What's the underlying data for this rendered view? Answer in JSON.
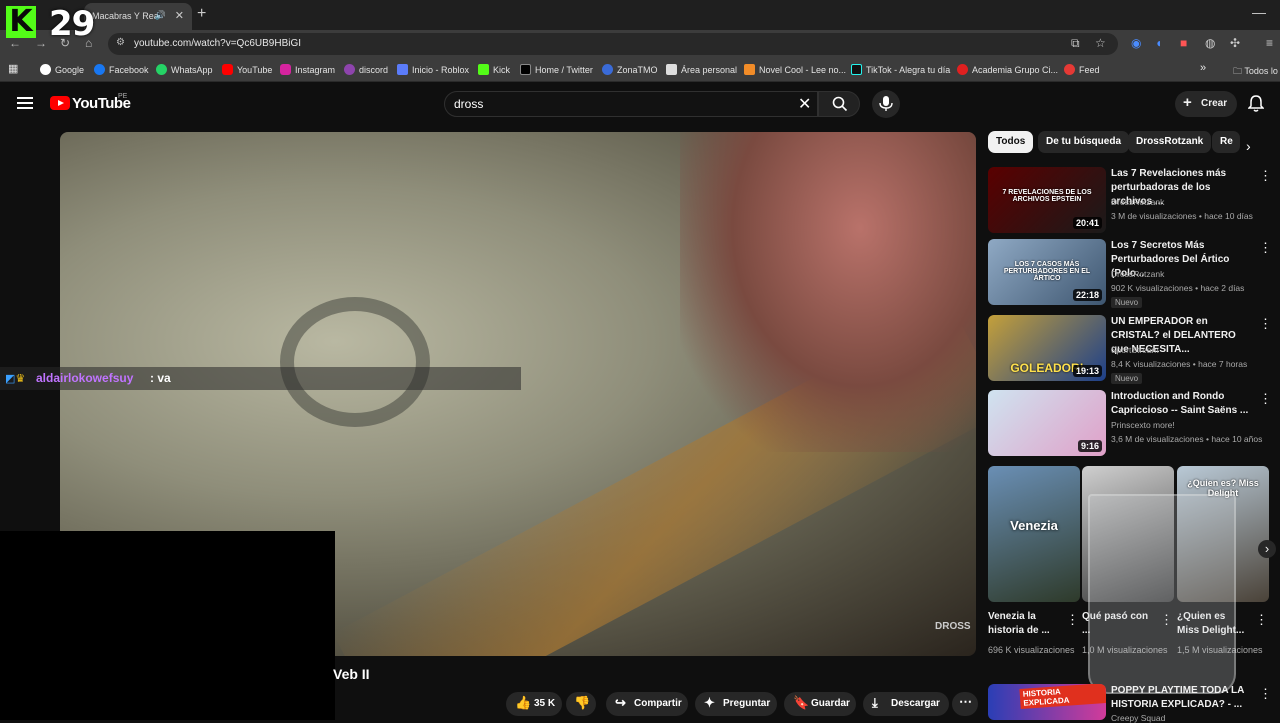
{
  "browser": {
    "tab_title": "Macabras Y Rea",
    "url": "youtube.com/watch?v=Qc6UB9HBiGI",
    "bookmarks": [
      "Google",
      "Facebook",
      "WhatsApp",
      "YouTube",
      "Instagram",
      "discord",
      "Inicio - Roblox",
      "Kick",
      "Home / Twitter",
      "ZonaTMO",
      "Área personal",
      "Novel Cool - Lee no...",
      "TikTok - Alegra tu día",
      "Academia Grupo Ci...",
      "Feed",
      "Todos lo"
    ]
  },
  "stream_overlay": {
    "logo": "K",
    "viewers": "29",
    "chat_user": "aldairlokowefsuy",
    "chat_message": ": va"
  },
  "youtube": {
    "logo_text": "YouTube",
    "region": "PE",
    "search_query": "dross",
    "create_label": "Crear"
  },
  "video": {
    "title_partial": "Veb II",
    "watermark": "DROSS"
  },
  "actions": {
    "likes": "35 K",
    "share": "Compartir",
    "ask": "Preguntar",
    "save": "Guardar",
    "download": "Descargar"
  },
  "chips": [
    "Todos",
    "De tu búsqueda",
    "DrossRotzank",
    "Re"
  ],
  "recommendations": [
    {
      "title": "Las 7 Revelaciones más perturbadoras de los archivos ...",
      "channel": "DrossRotzank",
      "views": "3 M de visualizaciones",
      "age": "hace 10 días",
      "duration": "20:41",
      "badge": "",
      "thumb_text": "7 REVELACIONES DE LOS ARCHIVOS EPSTEIN",
      "colors": [
        "#5a0000",
        "#1a1a1a"
      ]
    },
    {
      "title": "Los 7 Secretos Más Perturbadores Del Ártico (Polo...",
      "channel": "DrossRotzank",
      "views": "902 K visualizaciones",
      "age": "hace 2 días",
      "duration": "22:18",
      "badge": "Nuevo",
      "thumb_text": "LOS 7 CASOS MÁS PERTURBADORES EN EL ÁRTICO",
      "colors": [
        "#8fa9c4",
        "#3e5670"
      ]
    },
    {
      "title": "UN EMPERADOR en CRISTAL? el DELANTERO que NECESITA...",
      "channel": "SportStream",
      "views": "8,4 K visualizaciones",
      "age": "hace 7 horas",
      "duration": "19:13",
      "badge": "Nuevo",
      "thumb_text": "GOLEADOR!",
      "colors": [
        "#c4a03a",
        "#1c3f8a"
      ]
    },
    {
      "title": "Introduction and Rondo Capriccioso -- Saint Saëns ...",
      "channel": "Prinscexto more!",
      "views": "3,6 M de visualizaciones",
      "age": "hace 10 años",
      "duration": "9:16",
      "badge": "",
      "thumb_text": "",
      "colors": [
        "#cfe3f0",
        "#e0a0c8"
      ]
    }
  ],
  "shorts": [
    {
      "title": "Venezia la historia de ...",
      "meta": "696 K visualizaciones",
      "overlay": "Venezia"
    },
    {
      "title": "Qué pasó con ...",
      "meta": "1,0 M visualizaciones",
      "overlay": ""
    },
    {
      "title": "¿Quien es Miss Delight...",
      "meta": "1,5 M visualizaciones",
      "overlay": "¿Quien es? Miss Delight"
    }
  ],
  "bottom_rec": {
    "title": "POPPY PLAYTIME TODA LA HISTORIA EXPLICADA? - ...",
    "channel": "Creepy Squad",
    "thumb_text": "HISTORIA EXPLICADA"
  }
}
